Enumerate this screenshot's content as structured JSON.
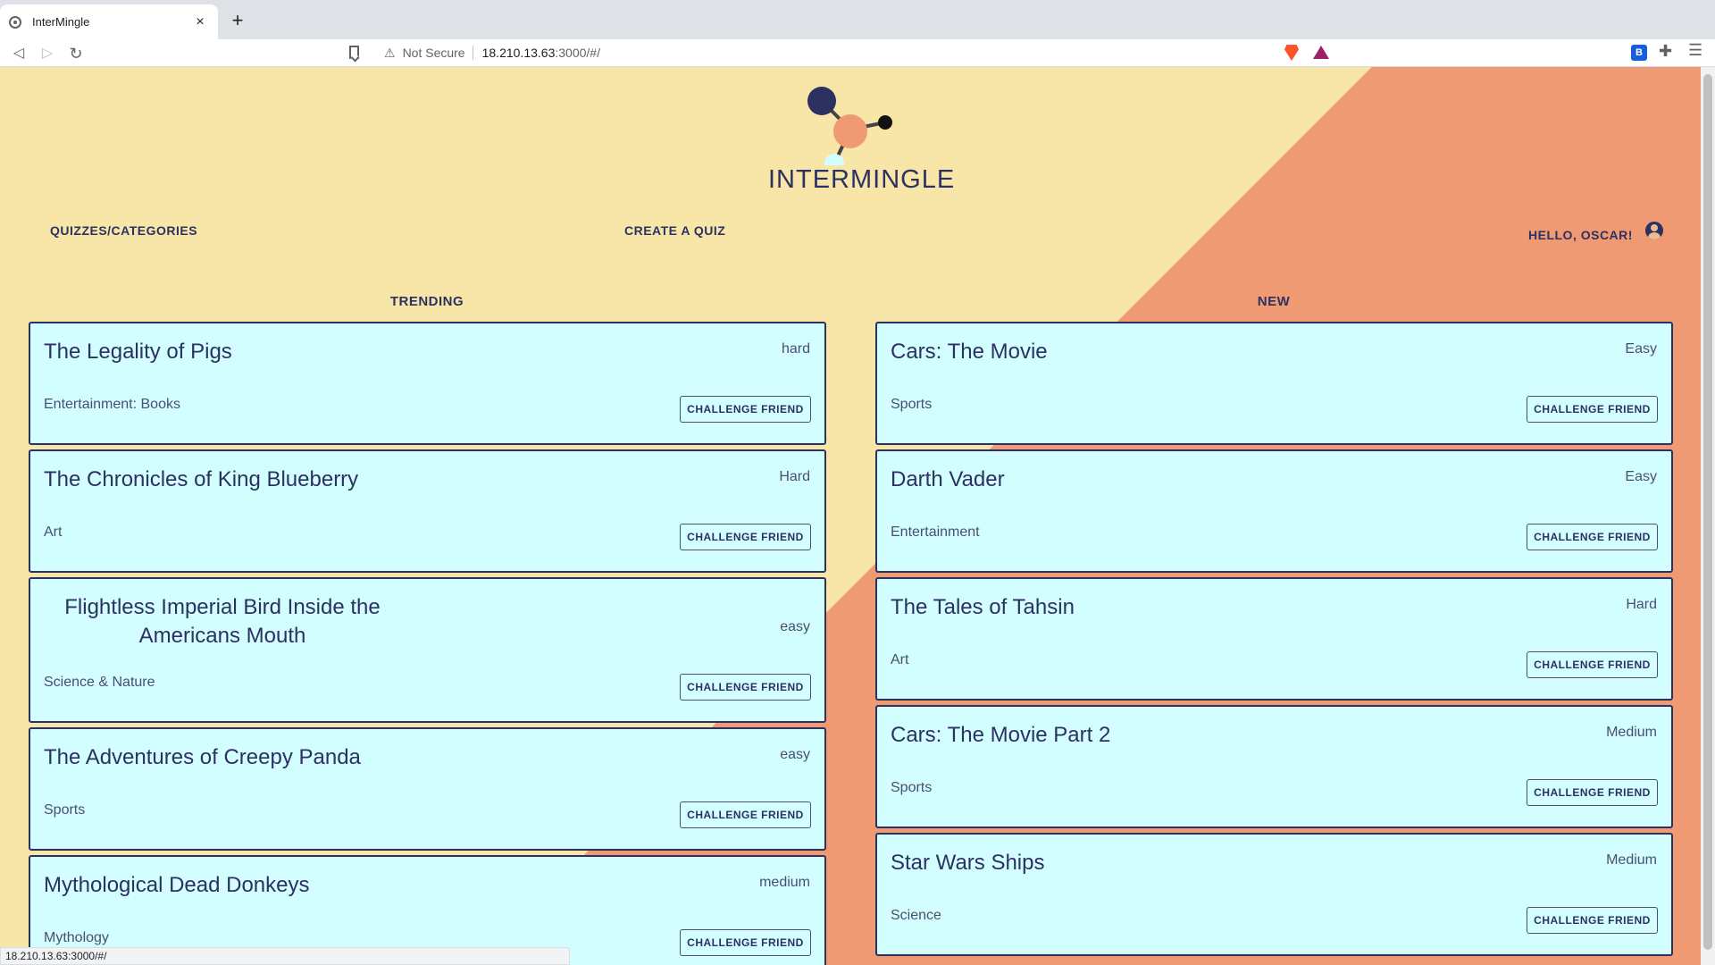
{
  "browser": {
    "tab_title": "InterMingle",
    "tab_close": "×",
    "new_tab": "+",
    "back": "◁",
    "forward": "▷",
    "reload": "↻",
    "warning_icon": "⚠",
    "not_secure": "Not Secure",
    "url_host": "18.210.13.63",
    "url_path": ":3000/#/",
    "menu": "☰",
    "ext1": "B",
    "ext2": "✚"
  },
  "logo": {
    "text": "INTERMINGLE",
    "colors": {
      "navy": "#2c3161",
      "coral": "#ef9a72",
      "black": "#111111",
      "cyan": "#d2feff"
    }
  },
  "nav": {
    "quizzes": "QUIZZES/CATEGORIES",
    "create": "CREATE A QUIZ",
    "greeting": "HELLO, OSCAR!"
  },
  "trending": {
    "heading": "TRENDING",
    "cards": [
      {
        "title": "The Legality of Pigs",
        "difficulty": "hard",
        "category": "Entertainment: Books",
        "button": "CHALLENGE FRIEND"
      },
      {
        "title": "The Chronicles of King Blueberry",
        "difficulty": "Hard",
        "category": "Art",
        "button": "CHALLENGE FRIEND"
      },
      {
        "title": "Flightless Imperial Bird Inside the Americans Mouth",
        "difficulty": "easy",
        "category": "Science & Nature",
        "button": "CHALLENGE FRIEND"
      },
      {
        "title": "The Adventures of Creepy Panda",
        "difficulty": "easy",
        "category": "Sports",
        "button": "CHALLENGE FRIEND"
      },
      {
        "title": "Mythological Dead Donkeys",
        "difficulty": "medium",
        "category": "Mythology",
        "button": "CHALLENGE FRIEND"
      }
    ]
  },
  "new": {
    "heading": "NEW",
    "cards": [
      {
        "title": "Cars: The Movie",
        "difficulty": "Easy",
        "category": "Sports",
        "button": "CHALLENGE FRIEND"
      },
      {
        "title": "Darth Vader",
        "difficulty": "Easy",
        "category": "Entertainment",
        "button": "CHALLENGE FRIEND"
      },
      {
        "title": "The Tales of Tahsin",
        "difficulty": "Hard",
        "category": "Art",
        "button": "CHALLENGE FRIEND"
      },
      {
        "title": "Cars: The Movie Part 2",
        "difficulty": "Medium",
        "category": "Sports",
        "button": "CHALLENGE FRIEND"
      },
      {
        "title": "Star Wars Ships",
        "difficulty": "Medium",
        "category": "Science",
        "button": "CHALLENGE FRIEND"
      }
    ]
  },
  "status_bar": "18.210.13.63:3000/#/",
  "theme": {
    "background_yellow": "#f7e6a8",
    "background_coral": "#ef9a72",
    "card": "#d2feff",
    "ink": "#2c3161"
  }
}
